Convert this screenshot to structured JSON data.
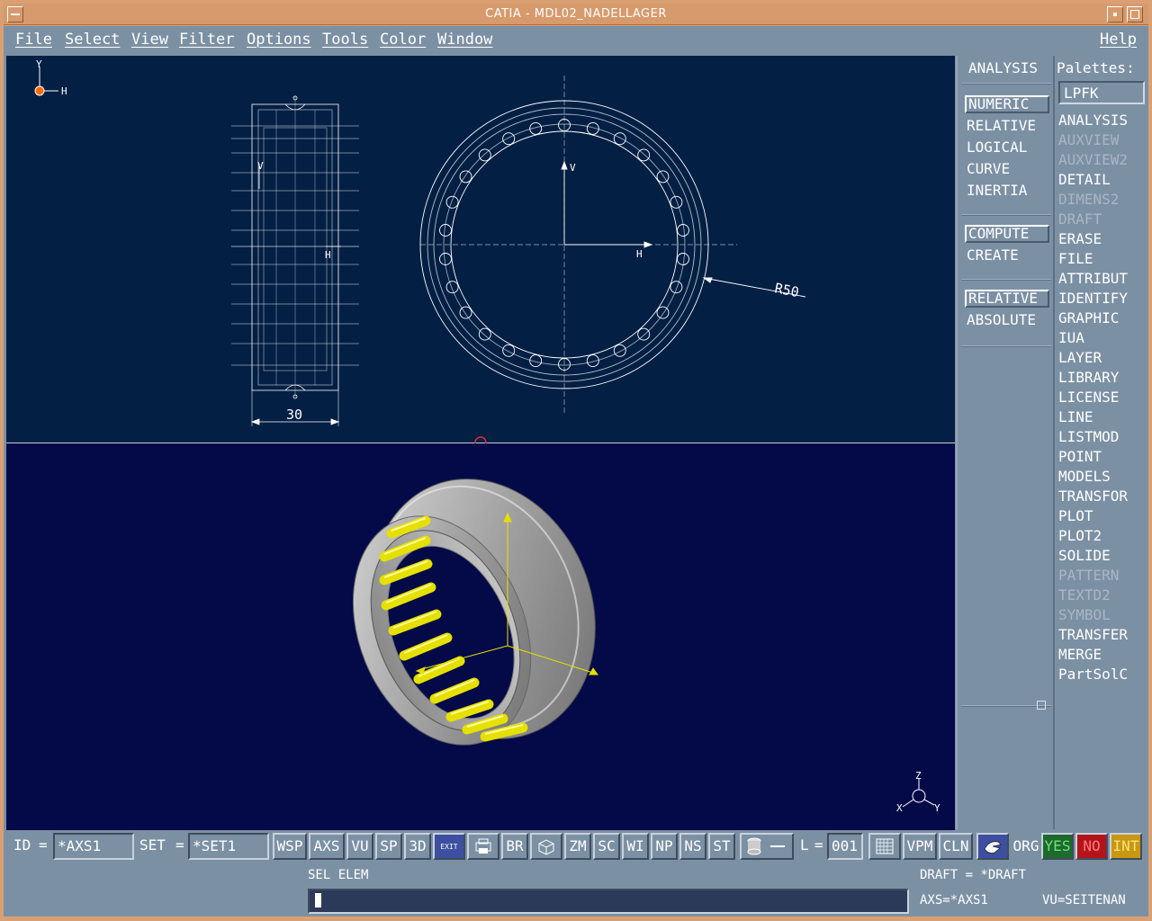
{
  "window": {
    "title": "CATIA - MDL02_NADELLAGER"
  },
  "menu": {
    "file": "File",
    "select": "Select",
    "view": "View",
    "filter": "Filter",
    "options": "Options",
    "tools": "Tools",
    "color": "Color",
    "window": "Window",
    "help": "Help"
  },
  "viewport": {
    "top_axis_y": "Y",
    "top_axis_h": "H",
    "side_v": "V",
    "side_h": "H",
    "front_v": "V",
    "front_h": "H",
    "dimension_width": "30",
    "radius_label": "R50",
    "bottom_axis_z": "Z",
    "bottom_axis_x": "X",
    "bottom_axis_y": "Y",
    "colors": {
      "top_background": "#031f44",
      "bottom_background": "#040a48",
      "drawing_lines": "#ffffff",
      "rollers": "#e6e000",
      "ring": "#a8a8a8",
      "origin_marker": "#ff6a00"
    }
  },
  "analysis_panel": {
    "heading": "ANALYSIS",
    "numeric": "NUMERIC",
    "relative": "RELATIVE",
    "logical": "LOGICAL",
    "curve": "CURVE",
    "inertia": "INERTIA",
    "compute": "COMPUTE",
    "create": "CREATE",
    "relative2": "RELATIVE",
    "absolute": "ABSOLUTE"
  },
  "palettes": {
    "label": "Palettes:",
    "current": "LPFK",
    "items": [
      {
        "label": "ANALYSIS",
        "enabled": true
      },
      {
        "label": "AUXVIEW",
        "enabled": false
      },
      {
        "label": "AUXVIEW2",
        "enabled": false
      },
      {
        "label": "DETAIL",
        "enabled": true
      },
      {
        "label": "DIMENS2",
        "enabled": false
      },
      {
        "label": "DRAFT",
        "enabled": false
      },
      {
        "label": "ERASE",
        "enabled": true
      },
      {
        "label": "FILE",
        "enabled": true
      },
      {
        "label": "ATTRIBUT",
        "enabled": true
      },
      {
        "label": "IDENTIFY",
        "enabled": true
      },
      {
        "label": "GRAPHIC",
        "enabled": true
      },
      {
        "label": "IUA",
        "enabled": true
      },
      {
        "label": "LAYER",
        "enabled": true
      },
      {
        "label": "LIBRARY",
        "enabled": true
      },
      {
        "label": "LICENSE",
        "enabled": true
      },
      {
        "label": "LINE",
        "enabled": true
      },
      {
        "label": "LISTMOD",
        "enabled": true
      },
      {
        "label": "POINT",
        "enabled": true
      },
      {
        "label": "MODELS",
        "enabled": true
      },
      {
        "label": "TRANSFOR",
        "enabled": true
      },
      {
        "label": "PLOT",
        "enabled": true
      },
      {
        "label": "PLOT2",
        "enabled": true
      },
      {
        "label": "SOLIDE",
        "enabled": true
      },
      {
        "label": "PATTERN",
        "enabled": false
      },
      {
        "label": "TEXTD2",
        "enabled": false
      },
      {
        "label": "SYMBOL",
        "enabled": false
      },
      {
        "label": "TRANSFER",
        "enabled": true
      },
      {
        "label": "MERGE",
        "enabled": true
      },
      {
        "label": "PartSolC",
        "enabled": true
      }
    ]
  },
  "toolbar": {
    "id_label": "ID",
    "id_eq": "=",
    "id_value": "*AXS1",
    "set_label": "SET",
    "set_eq": "=",
    "set_value": "*SET1",
    "wsp": "WSP",
    "axs": "AXS",
    "vu": "VU",
    "sp": "SP",
    "three_d": "3D",
    "exit": "EXIT",
    "br": "BR",
    "zm": "ZM",
    "sc": "SC",
    "wi": "WI",
    "np": "NP",
    "ns": "NS",
    "st": "ST",
    "l_label": "L",
    "l_eq": "=",
    "l_value": "001",
    "vpm": "VPM",
    "cln": "CLN",
    "org": "ORG",
    "yes": "YES",
    "no": "NO",
    "int": "INT",
    "colors": {
      "yes": "#1d6a2c",
      "no": "#b3141c",
      "int": "#c89812",
      "exit": "#3d4fa0"
    }
  },
  "status": {
    "prompt": "SEL ELEM",
    "draft": "DRAFT  = *DRAFT",
    "axs": "AXS=*AXS1",
    "vu": "VU=SEITENAN"
  }
}
